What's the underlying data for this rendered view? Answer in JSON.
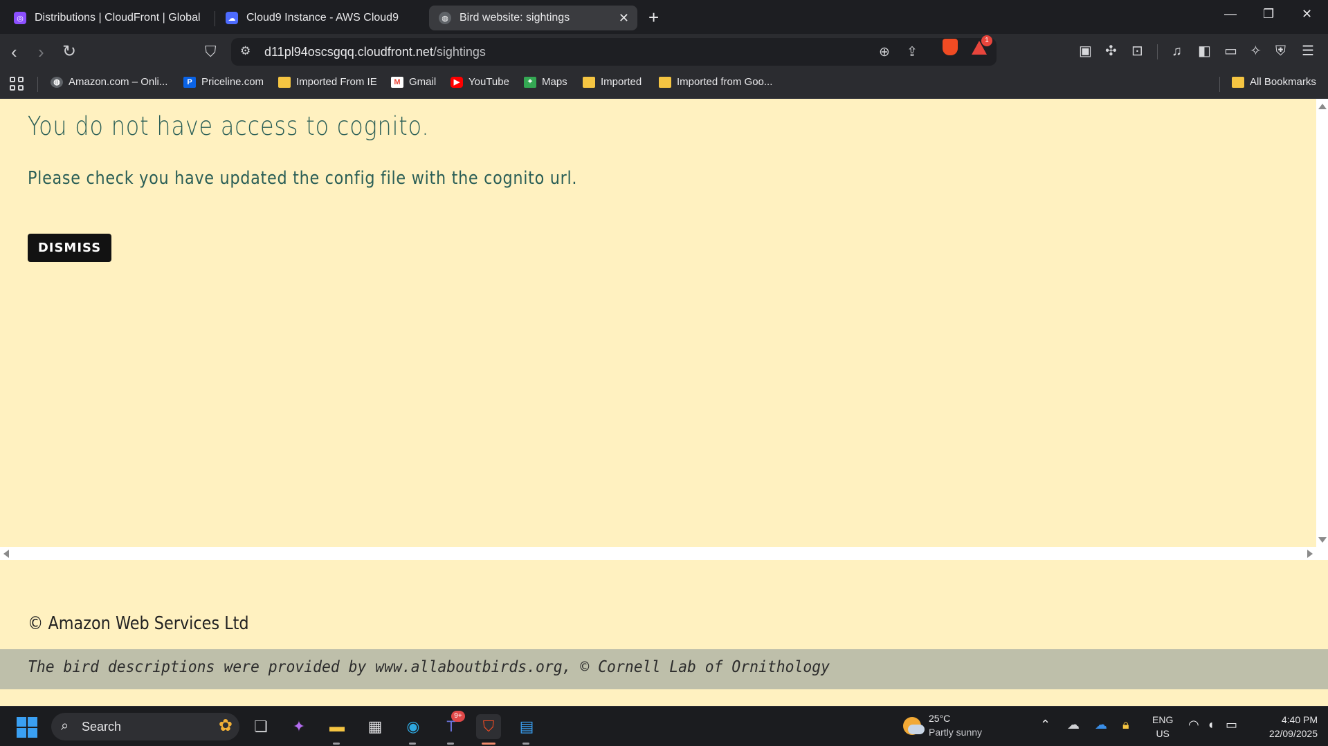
{
  "tabs": [
    {
      "title": "Distributions | CloudFront | Global",
      "favicon_color": "#8c4fff"
    },
    {
      "title": "Cloud9 Instance - AWS Cloud9",
      "favicon_color": "#4d6bfe"
    },
    {
      "title": "Bird website: sightings",
      "favicon_color": "#5f6368",
      "active": true
    }
  ],
  "toolbar": {
    "url_host": "d11pl94oscsgqq.cloudfront.net",
    "url_path": "/sightings",
    "rewards_count": "1"
  },
  "bookmarks": {
    "items": [
      {
        "label": "Amazon.com – Onli..."
      },
      {
        "label": "Priceline.com"
      },
      {
        "label": "Imported From IE"
      },
      {
        "label": "Gmail"
      },
      {
        "label": "YouTube"
      },
      {
        "label": "Maps"
      },
      {
        "label": "Imported"
      },
      {
        "label": "Imported from Goo..."
      }
    ],
    "all_bookmarks": "All Bookmarks"
  },
  "page": {
    "error_title": "You do not have access to cognito.",
    "error_message": "Please check you have updated the config file with the cognito url.",
    "dismiss_label": "DISMISS",
    "copyright": "© Amazon Web Services Ltd",
    "credits": "The bird descriptions were provided by www.allaboutbirds.org, © Cornell Lab of Ornithology"
  },
  "colors": {
    "page_bg": "#fff1c0",
    "heading_text": "#2a5e56",
    "credits_bg": "#bebfaa",
    "button_bg": "#121212"
  },
  "taskbar": {
    "search_label": "Search",
    "teams_badge": "9+",
    "weather_temp": "25°C",
    "weather_desc": "Partly sunny",
    "lang_line1": "ENG",
    "lang_line2": "US",
    "time": "4:40 PM",
    "date": "22/09/2025"
  }
}
